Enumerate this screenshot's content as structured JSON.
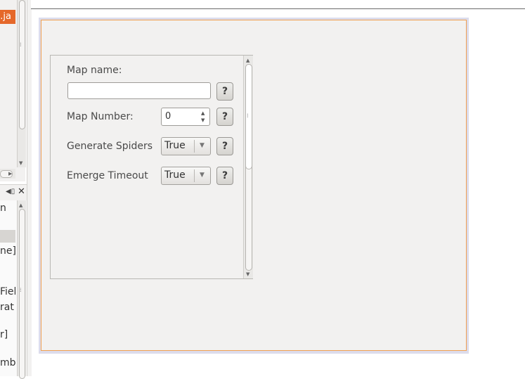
{
  "left_panel": {
    "tab_fragment": "n.ja",
    "lower_fragments": [
      "n",
      "ne]",
      "Fiel",
      "rat",
      "r]",
      "mbo"
    ]
  },
  "form": {
    "map_name_label": "Map name:",
    "map_name_value": "",
    "map_number_label": "Map Number:",
    "map_number_value": "0",
    "generate_spiders_label": "Generate Spiders",
    "generate_spiders_value": "True",
    "emerge_timeout_label": "Emerge Timeout",
    "emerge_timeout_value": "True",
    "help_label": "?"
  },
  "icons": {
    "left_header": [
      "speaker-icon",
      "close-icon"
    ],
    "scroll_arrows": [
      "arrow-up-icon",
      "arrow-down-icon"
    ]
  },
  "colors": {
    "accent_tab": "#e5682a",
    "design_frame_border": "#f0a050",
    "panel_bg": "#f2f1f0"
  }
}
